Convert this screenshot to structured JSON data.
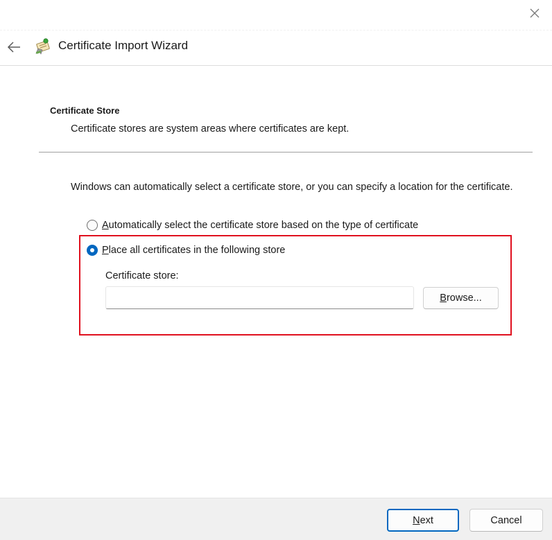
{
  "window": {
    "close_icon": "close-icon"
  },
  "header": {
    "back_icon": "back-arrow-icon",
    "app_icon": "certificate-wizard-icon",
    "title": "Certificate Import Wizard"
  },
  "section": {
    "title": "Certificate Store",
    "description": "Certificate stores are system areas where certificates are kept."
  },
  "intro_text": "Windows can automatically select a certificate store, or you can specify a location for the certificate.",
  "options": {
    "auto": {
      "accel": "A",
      "rest": "utomatically select the certificate store based on the type of certificate",
      "selected": false
    },
    "place": {
      "accel": "P",
      "rest": "lace all certificates in the following store",
      "selected": true
    }
  },
  "store": {
    "label": "Certificate store:",
    "value": "",
    "browse_accel": "B",
    "browse_rest": "rowse..."
  },
  "highlight_color": "#e0101e",
  "accent_color": "#0067c0",
  "footer": {
    "next_accel": "N",
    "next_rest": "ext",
    "cancel_label": "Cancel"
  }
}
